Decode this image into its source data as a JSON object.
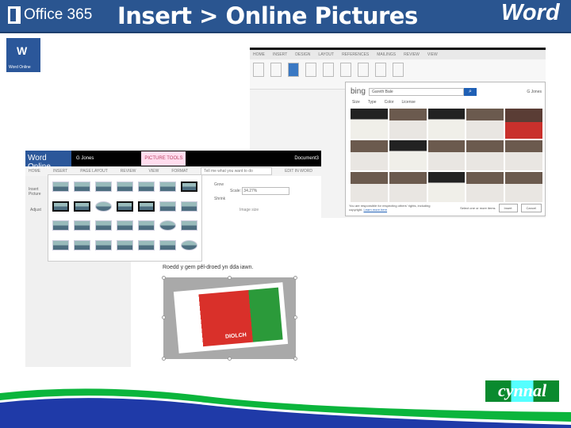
{
  "header": {
    "brand": "Office 365",
    "title": "Insert > Online Pictures",
    "app": "Word"
  },
  "tile": {
    "label": "Word Online",
    "letter": "W"
  },
  "ribbon": {
    "tabs": [
      "HOME",
      "INSERT",
      "DESIGN",
      "LAYOUT",
      "REFERENCES",
      "MAILINGS",
      "REVIEW",
      "VIEW"
    ]
  },
  "bing": {
    "logo": "bing",
    "query": "Gareth Bale",
    "filters": [
      "Size",
      "Type",
      "Color",
      "License"
    ],
    "user": "G Jones",
    "note": "You are responsible for respecting others' rights, including copyright.",
    "learn": "Learn more here",
    "select_label": "Select one or more items",
    "insert": "Insert",
    "cancel": "Cancel"
  },
  "word_online": {
    "brand": "Word Online",
    "user": "G Jones",
    "context": "PICTURE TOOLS",
    "doc": "Document3",
    "tabs": [
      "HOME",
      "INSERT",
      "PAGE LAYOUT",
      "REVIEW",
      "VIEW",
      "FORMAT"
    ],
    "tell": "Tell me what you want to do",
    "edit": "EDIT IN WORD",
    "insert_picture": "Insert Picture",
    "adjust": "Adjust",
    "grow": "Grow",
    "shrink": "Shrink",
    "scale_label": "Scale:",
    "scale_value": "34.27%",
    "image_size": "Image size"
  },
  "doc": {
    "paragraph": "Roedd y gem pêl-droed yn dda iawn.",
    "shirt": "DIOLCH"
  },
  "footer": {
    "logo": "cynnal"
  }
}
